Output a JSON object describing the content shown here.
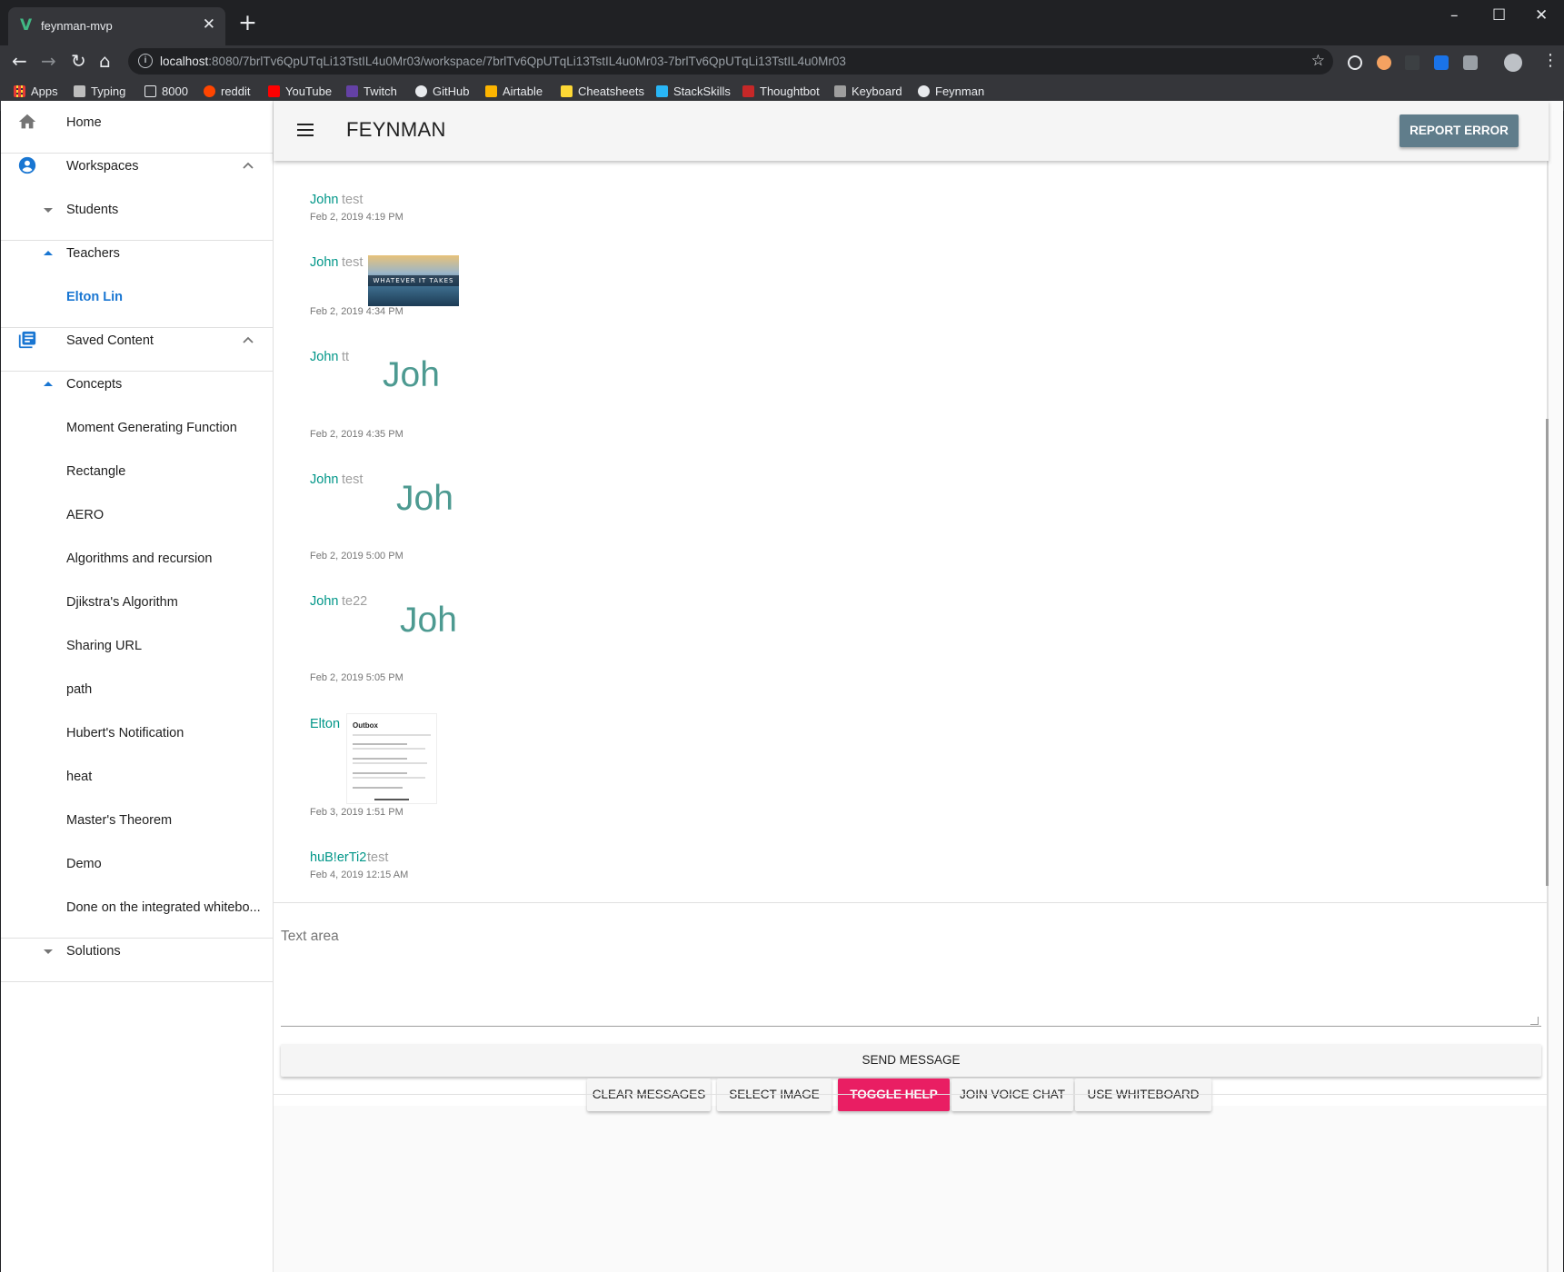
{
  "browser": {
    "tab_title": "feynman-mvp",
    "new_tab": "+",
    "window_controls": {
      "minimize": "–",
      "maximize": "☐",
      "close": "✕"
    },
    "url_host": "localhost",
    "url_rest": ":8080/7brlTv6QpUTqLi13TstIL4u0Mr03/workspace/7brlTv6QpUTqLi13TstIL4u0Mr03-7brlTv6QpUTqLi13TstIL4u0Mr03",
    "bookmarks": [
      {
        "label": "Apps",
        "color": "#e53935"
      },
      {
        "label": "Typing",
        "color": "#bdbdbd"
      },
      {
        "label": "8000",
        "color": "#e8eaed"
      },
      {
        "label": "reddit",
        "color": "#ff4500"
      },
      {
        "label": "YouTube",
        "color": "#ff0000"
      },
      {
        "label": "Twitch",
        "color": "#6441a5"
      },
      {
        "label": "GitHub",
        "color": "#e8eaed"
      },
      {
        "label": "Airtable",
        "color": "#fcb400"
      },
      {
        "label": "Cheatsheets",
        "color": "#fdd835"
      },
      {
        "label": "StackSkills",
        "color": "#29b6f6"
      },
      {
        "label": "Thoughtbot",
        "color": "#c62828"
      },
      {
        "label": "Keyboard",
        "color": "#9e9e9e"
      },
      {
        "label": "Feynman",
        "color": "#e8eaed"
      }
    ]
  },
  "sidebar": {
    "home": "Home",
    "workspaces": "Workspaces",
    "students": "Students",
    "teachers": "Teachers",
    "active_teacher": "Elton Lin",
    "saved_content": "Saved Content",
    "concepts": "Concepts",
    "concept_items": [
      "Moment Generating Function",
      "Rectangle",
      "AERO",
      "Algorithms and recursion",
      "Djikstra's Algorithm",
      "Sharing URL",
      "path",
      "Hubert's Notification",
      "heat",
      "Master's Theorem",
      "Demo",
      "Done on the integrated whitebo..."
    ],
    "solutions": "Solutions"
  },
  "header": {
    "title": "FEYNMAN",
    "report_button": "REPORT ERROR"
  },
  "messages": [
    {
      "author": "John",
      "text": "test",
      "time": "Feb 2, 2019 4:19 PM"
    },
    {
      "author": "John",
      "text": "test",
      "time": "Feb 2, 2019 4:34 PM",
      "image_caption": "WHATEVER IT TAKES"
    },
    {
      "author": "John",
      "text": "tt",
      "time": "Feb 2, 2019 4:35 PM",
      "image_text": "Joh"
    },
    {
      "author": "John",
      "text": "test",
      "time": "Feb 2, 2019 5:00 PM",
      "image_text": "Joh"
    },
    {
      "author": "John",
      "text": "te22",
      "time": "Feb 2, 2019 5:05 PM",
      "image_text": "Joh"
    },
    {
      "author": "Elton",
      "text": "",
      "time": "Feb 3, 2019 1:51 PM",
      "image_title": "Outbox"
    },
    {
      "author": "huB!erTi2",
      "text": "test",
      "time": "Feb 4, 2019 12:15 AM"
    }
  ],
  "composer": {
    "placeholder": "Text area",
    "send": "SEND MESSAGE",
    "actions": [
      "CLEAR MESSAGES",
      "SELECT IMAGE",
      "TOGGLE HELP",
      "JOIN VOICE CHAT",
      "USE WHITEBOARD"
    ]
  },
  "colors": {
    "accent_primary": "#1976d2",
    "author_name": "#009688",
    "toggle_help": "#e91e63",
    "report_button": "#607d8b"
  }
}
